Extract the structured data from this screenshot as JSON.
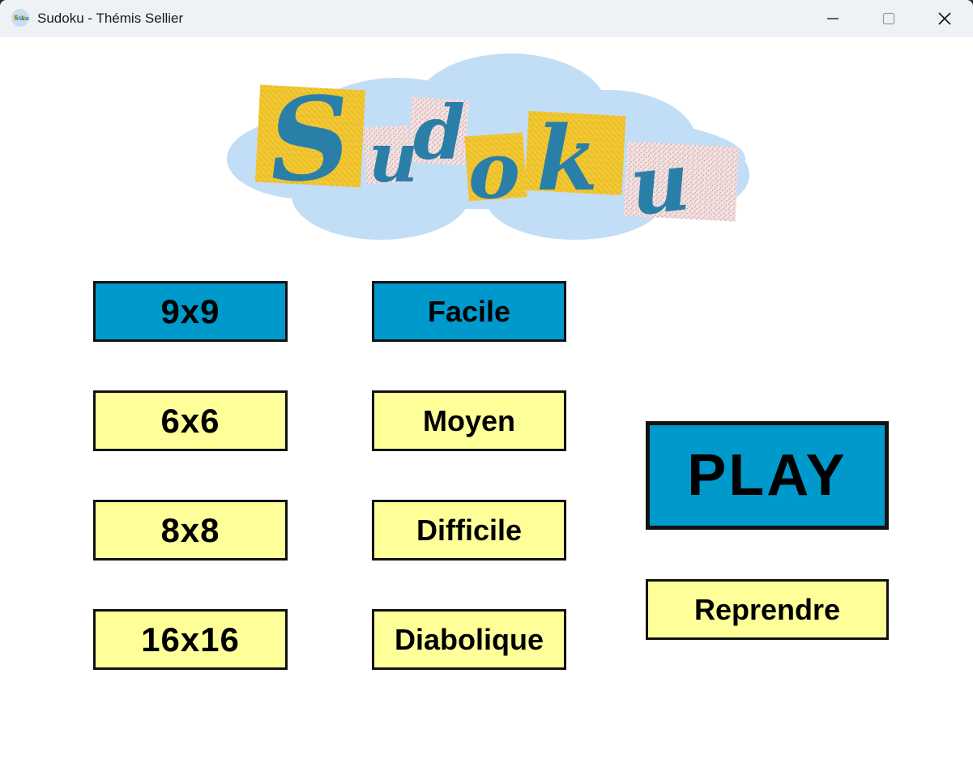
{
  "window": {
    "title": "Sudoku - Thémis Sellier",
    "controls": [
      "minimize-icon",
      "maximize-icon",
      "close-icon"
    ]
  },
  "logo": {
    "text": "Sudoku",
    "colors": {
      "cloud": "#bfdcf5",
      "letters": "#2a7fa8",
      "yellow_patch": "#f2c832",
      "pink_patch": "#f1dede"
    }
  },
  "grid_sizes": {
    "selected": "9x9",
    "items": [
      {
        "label": "9x9",
        "selected": true
      },
      {
        "label": "6x6",
        "selected": false
      },
      {
        "label": "8x8",
        "selected": false
      },
      {
        "label": "16x16",
        "selected": false
      }
    ]
  },
  "difficulty": {
    "selected": "Facile",
    "items": [
      {
        "label": "Facile",
        "selected": true
      },
      {
        "label": "Moyen",
        "selected": false
      },
      {
        "label": "Difficile",
        "selected": false
      },
      {
        "label": "Diabolique",
        "selected": false
      }
    ]
  },
  "actions": {
    "play_label": "PLAY",
    "resume_label": "Reprendre"
  },
  "colors": {
    "selected": "#0099cc",
    "unselected": "#ffff99",
    "border": "#111111"
  }
}
